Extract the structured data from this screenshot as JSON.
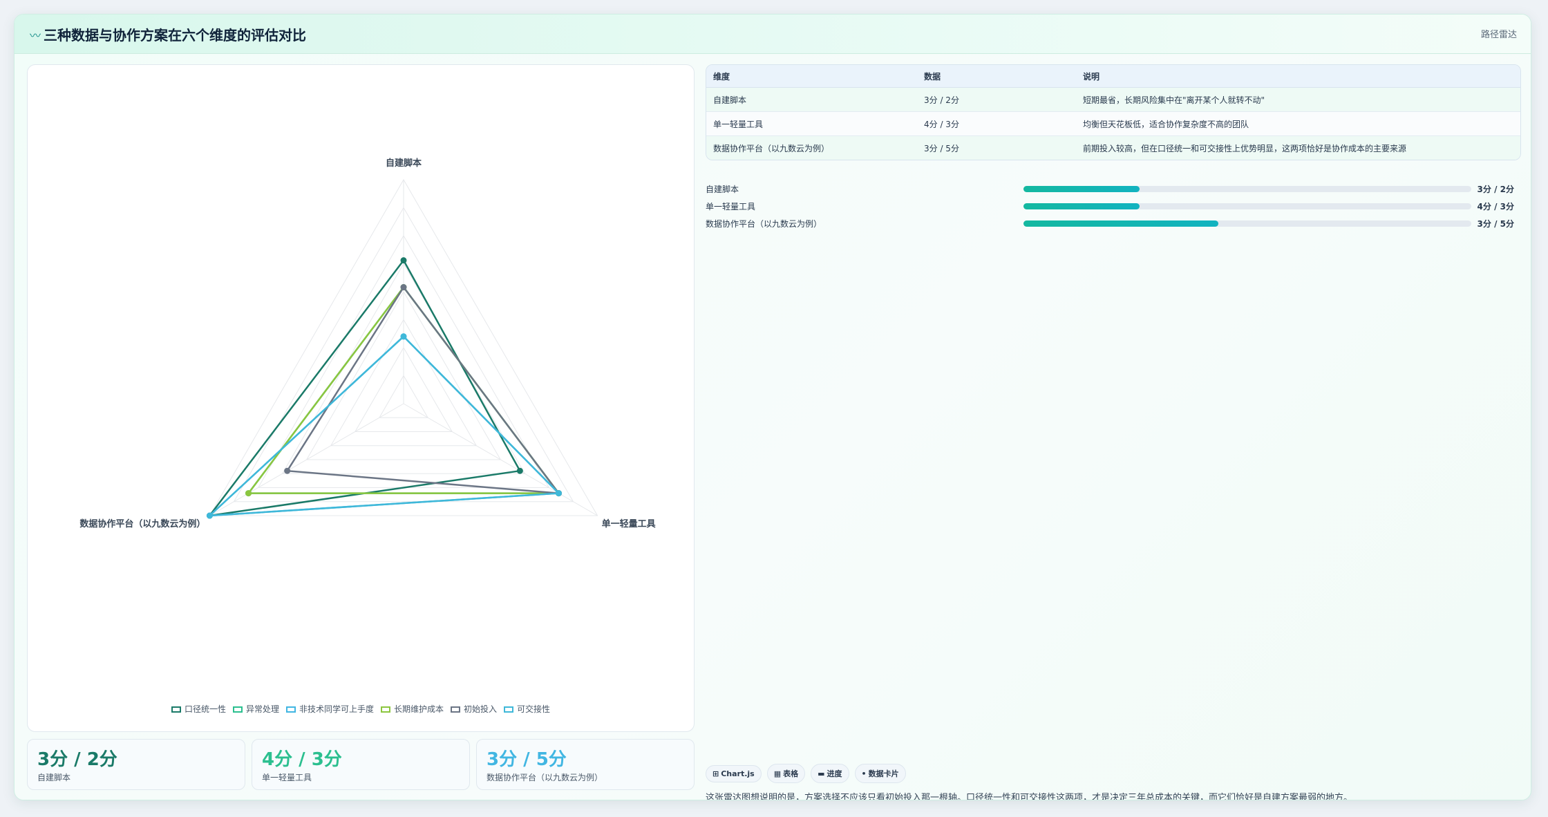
{
  "header": {
    "icon": "〰",
    "title": "三种数据与协作方案在六个维度的评估对比",
    "tag": "路径雷达"
  },
  "chart_data": {
    "type": "radar",
    "axes": [
      "自建脚本",
      "单一轻量工具",
      "数据协作平台（以九数云为例）"
    ],
    "rmax": 5,
    "levels": 8,
    "series": [
      {
        "name": "口径统一性",
        "values": [
          3.2,
          3.0,
          5.0
        ],
        "color": "#1a7a68"
      },
      {
        "name": "异常处理",
        "values": [
          2.6,
          4.0,
          4.0
        ],
        "color": "#2bbf8f"
      },
      {
        "name": "非技术同学可上手度",
        "values": [
          1.5,
          4.0,
          5.0
        ],
        "color": "#41b6e2"
      },
      {
        "name": "长期维护成本",
        "values": [
          2.6,
          4.0,
          4.0
        ],
        "color": "#8cc63f"
      },
      {
        "name": "初始投入",
        "values": [
          2.6,
          4.0,
          3.0
        ],
        "color": "#6b7585"
      },
      {
        "name": "可交接性",
        "values": [
          1.5,
          4.0,
          5.0
        ],
        "color": "#3fb8d9"
      }
    ]
  },
  "kpis": [
    {
      "value": "3分 / 2分",
      "label": "自建脚本",
      "color": "#1a7a68"
    },
    {
      "value": "4分 / 3分",
      "label": "单一轻量工具",
      "color": "#2bbf8f"
    },
    {
      "value": "3分 / 5分",
      "label": "数据协作平台（以九数云为例）",
      "color": "#41b6e2"
    }
  ],
  "table": {
    "headers": [
      "维度",
      "数据",
      "说明"
    ],
    "rows": [
      [
        "自建脚本",
        "3分 / 2分",
        "短期最省，长期风险集中在\"离开某个人就转不动\""
      ],
      [
        "单一轻量工具",
        "4分 / 3分",
        "均衡但天花板低，适合协作复杂度不高的团队"
      ],
      [
        "数据协作平台（以九数云为例）",
        "3分 / 5分",
        "前期投入较高，但在口径统一和可交接性上优势明显，这两项恰好是协作成本的主要来源"
      ]
    ]
  },
  "bars": [
    {
      "label": "自建脚本",
      "value": "3分 / 2分",
      "fraction": 0.26
    },
    {
      "label": "单一轻量工具",
      "value": "4分 / 3分",
      "fraction": 0.26
    },
    {
      "label": "数据协作平台（以九数云为例）",
      "value": "3分 / 5分",
      "fraction": 0.435
    }
  ],
  "chips": [
    {
      "icon": "⊞",
      "label": "Chart.js"
    },
    {
      "icon": "▦",
      "label": "表格"
    },
    {
      "icon": "▬",
      "label": "进度"
    },
    {
      "icon": "•",
      "label": "数据卡片"
    }
  ],
  "note": "这张雷达图想说明的是，方案选择不应该只看初始投入那一根轴。口径统一性和可交接性这两项，才是决定三年总成本的关键，而它们恰好是自建方案最弱的地方。"
}
